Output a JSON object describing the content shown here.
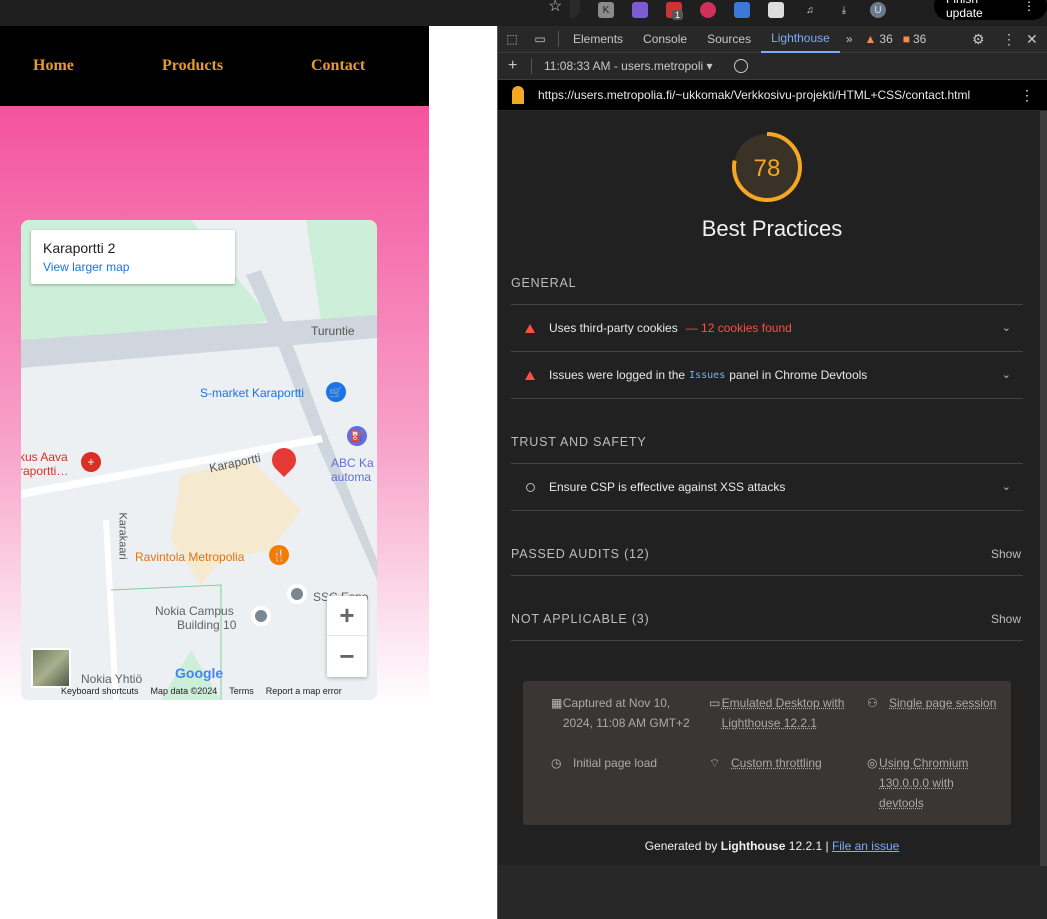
{
  "browser": {
    "finish_update": "Finish update",
    "ext_badge": "1"
  },
  "site": {
    "nav": [
      "Home",
      "Products",
      "Contact"
    ]
  },
  "map": {
    "card_title": "Karaportti 2",
    "card_link": "View larger map",
    "labels": {
      "turuntie": "Turuntie",
      "smarket": "S-market Karaportti",
      "aava1": "kus Aava",
      "aava2": "raportti…",
      "karaportti_road": "Karaportti",
      "abc1": "ABC Ka",
      "abc2": "automa",
      "karakaari": "Karakaari",
      "ravintola": "Ravintola Metropolia",
      "nokia1": "Nokia Campus",
      "nokia2": "Building 10",
      "ssc": "SSC Espo",
      "nokia_yhtio": "Nokia Yhtiö",
      "google": "Google"
    },
    "zoom_in": "+",
    "zoom_out": "−",
    "footer": [
      "Keyboard shortcuts",
      "Map data ©2024",
      "Terms",
      "Report a map error"
    ]
  },
  "devtools": {
    "tabs": [
      "Elements",
      "Console",
      "Sources",
      "Lighthouse"
    ],
    "active_tab": "Lighthouse",
    "warnings": "36",
    "issues": "36",
    "report_select": "11:08:33 AM - users.metropoli",
    "url": "https://users.metropolia.fi/~ukkomak/Verkkosivu-projekti/HTML+CSS/contact.html",
    "score": 78,
    "score_fraction": 0.78,
    "score_color": "#f5a623",
    "category": "Best Practices",
    "groups": {
      "general": "GENERAL",
      "trust": "TRUST AND SAFETY",
      "passed": "PASSED AUDITS (12)",
      "na": "NOT APPLICABLE (3)",
      "show": "Show"
    },
    "audits": {
      "cookies": "Uses third-party cookies",
      "cookies_detail": "— 12 cookies found",
      "issues_pre": "Issues were logged in the",
      "issues_code": "Issues",
      "issues_post": "panel in Chrome Devtools",
      "csp": "Ensure CSP is effective against XSS attacks"
    },
    "env": {
      "captured": "Captured at Nov 10, 2024, 11:08 AM GMT+2",
      "initial": "Initial page load",
      "emulated": "Emulated Desktop with Lighthouse 12.2.1",
      "throttling": "Custom throttling",
      "single": "Single page session",
      "chromium": "Using Chromium 130.0.0.0 with devtools"
    },
    "footer_pre": "Generated by",
    "footer_brand": "Lighthouse",
    "footer_version": "12.2.1 |",
    "footer_link": "File an issue"
  }
}
